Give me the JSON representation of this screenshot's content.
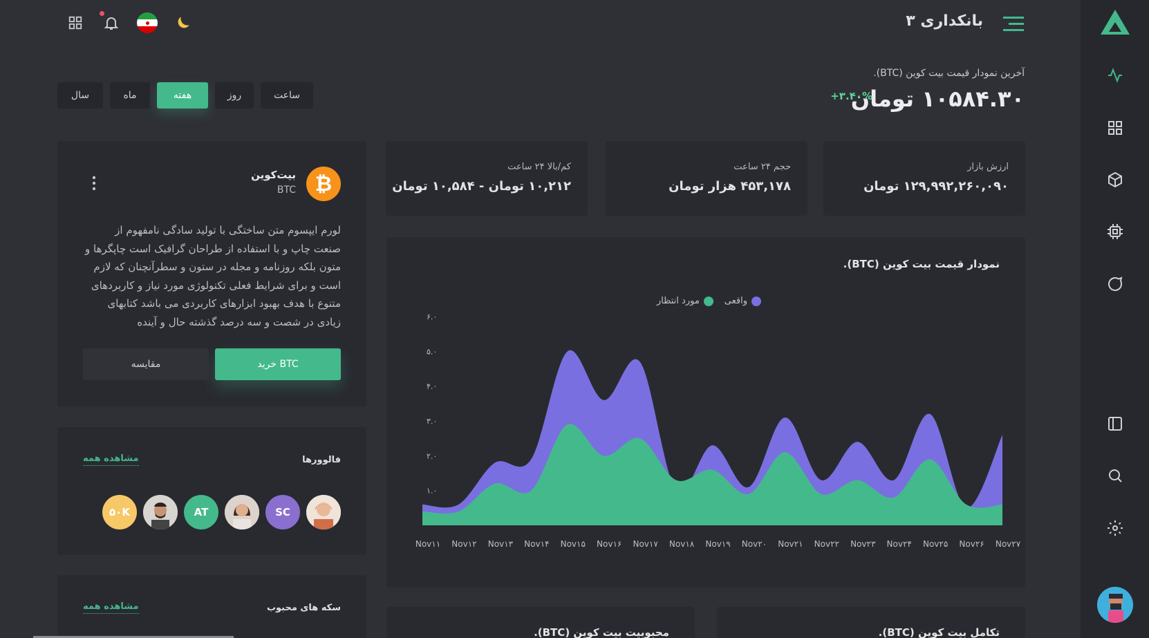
{
  "header": {
    "title": "بانکداری ۳"
  },
  "price": {
    "subtitle": "آخرین نمودار قیمت بیت کوین (BTC).",
    "value": "۱۰۵۸۴.۳۰ تومان",
    "change": "+۳.۴۰%"
  },
  "tabs": [
    {
      "label": "ساعت",
      "active": false
    },
    {
      "label": "روز",
      "active": false
    },
    {
      "label": "هفته",
      "active": true
    },
    {
      "label": "ماه",
      "active": false
    },
    {
      "label": "سال",
      "active": false
    }
  ],
  "stats": [
    {
      "label": "ارزش بازار",
      "value": "۱۲۹,۹۹۲,۲۶۰,۰۹۰ تومان"
    },
    {
      "label": "حجم ۲۴ ساعت",
      "value": "۴۵۳,۱۷۸ هزار تومان"
    },
    {
      "label": "کم/بالا ۲۴ ساعت",
      "value": "۱۰,۲۱۲ تومان - ۱۰,۵۸۴ تومان"
    }
  ],
  "coin": {
    "name": "بیت‌کوین",
    "symbol": "BTC",
    "description": "لورم ایپسوم متن ساختگی با تولید سادگی نامفهوم از صنعت چاپ و با استفاده از طراحان گرافیک است چاپگرها و متون بلکه روزنامه و مجله در ستون و سطرآنچنان که لازم است و برای شرایط فعلی تکنولوژی مورد نیاز و کاربردهای متنوع با هدف بهبود ابزارهای کاربردی می باشد کتابهای زیادی در شصت و سه درصد گذشته حال و آینده",
    "buy_label": "خرید BTC",
    "compare_label": "مقایسه"
  },
  "followers": {
    "title": "فالوورها",
    "see_all": "مشاهده همه",
    "items": [
      {
        "type": "photo",
        "label": "",
        "color": "#f0d2c0"
      },
      {
        "type": "initials",
        "label": "SC",
        "color": "#8a6fcf"
      },
      {
        "type": "photo",
        "label": "",
        "color": "#d9c2b4"
      },
      {
        "type": "initials",
        "label": "AT",
        "color": "#44b98c"
      },
      {
        "type": "photo",
        "label": "",
        "color": "#c9b7a8"
      },
      {
        "type": "count",
        "label": "۵۰K",
        "color": "#f7c867"
      }
    ]
  },
  "favorites": {
    "title": "سکه های محبوب",
    "see_all": "مشاهده همه"
  },
  "bottom_cards": {
    "left_title": "محبوبیت بیت کوین (BTC).",
    "right_title": "تکامل بیت کوین (BTC)."
  },
  "chart_data": {
    "type": "area",
    "title": "نمودار قیمت بیت کوین (BTC).",
    "x": [
      "Nov۱۱",
      "Nov۱۲",
      "Nov۱۳",
      "Nov۱۴",
      "Nov۱۵",
      "Nov۱۶",
      "Nov۱۷",
      "Nov۱۸",
      "Nov۱۹",
      "Nov۲۰",
      "Nov۲۱",
      "Nov۲۲",
      "Nov۲۳",
      "Nov۲۴",
      "Nov۲۵",
      "Nov۲۶",
      "Nov۲۷"
    ],
    "y_ticks": [
      "۱.۰",
      "۲.۰",
      "۳.۰",
      "۴.۰",
      "۵.۰",
      "۶.۰"
    ],
    "ylim": [
      0,
      6
    ],
    "legend_position": "top",
    "series": [
      {
        "name": "مورد انتظار",
        "color": "#44b98c",
        "values": [
          0.4,
          0.4,
          1.2,
          1.0,
          2.9,
          2.0,
          2.5,
          1.3,
          1.6,
          0.9,
          2.1,
          0.9,
          1.3,
          0.8,
          1.9,
          0.6,
          0.6
        ]
      },
      {
        "name": "واقعی",
        "color": "#7a6fe0",
        "values": [
          0.6,
          0.6,
          1.8,
          1.9,
          5.0,
          3.6,
          4.7,
          1.0,
          2.3,
          1.1,
          3.1,
          1.3,
          2.4,
          1.3,
          3.2,
          0.5,
          2.6
        ]
      }
    ],
    "colors": {
      "expected": "#44b98c",
      "actual": "#7a6fe0"
    }
  }
}
